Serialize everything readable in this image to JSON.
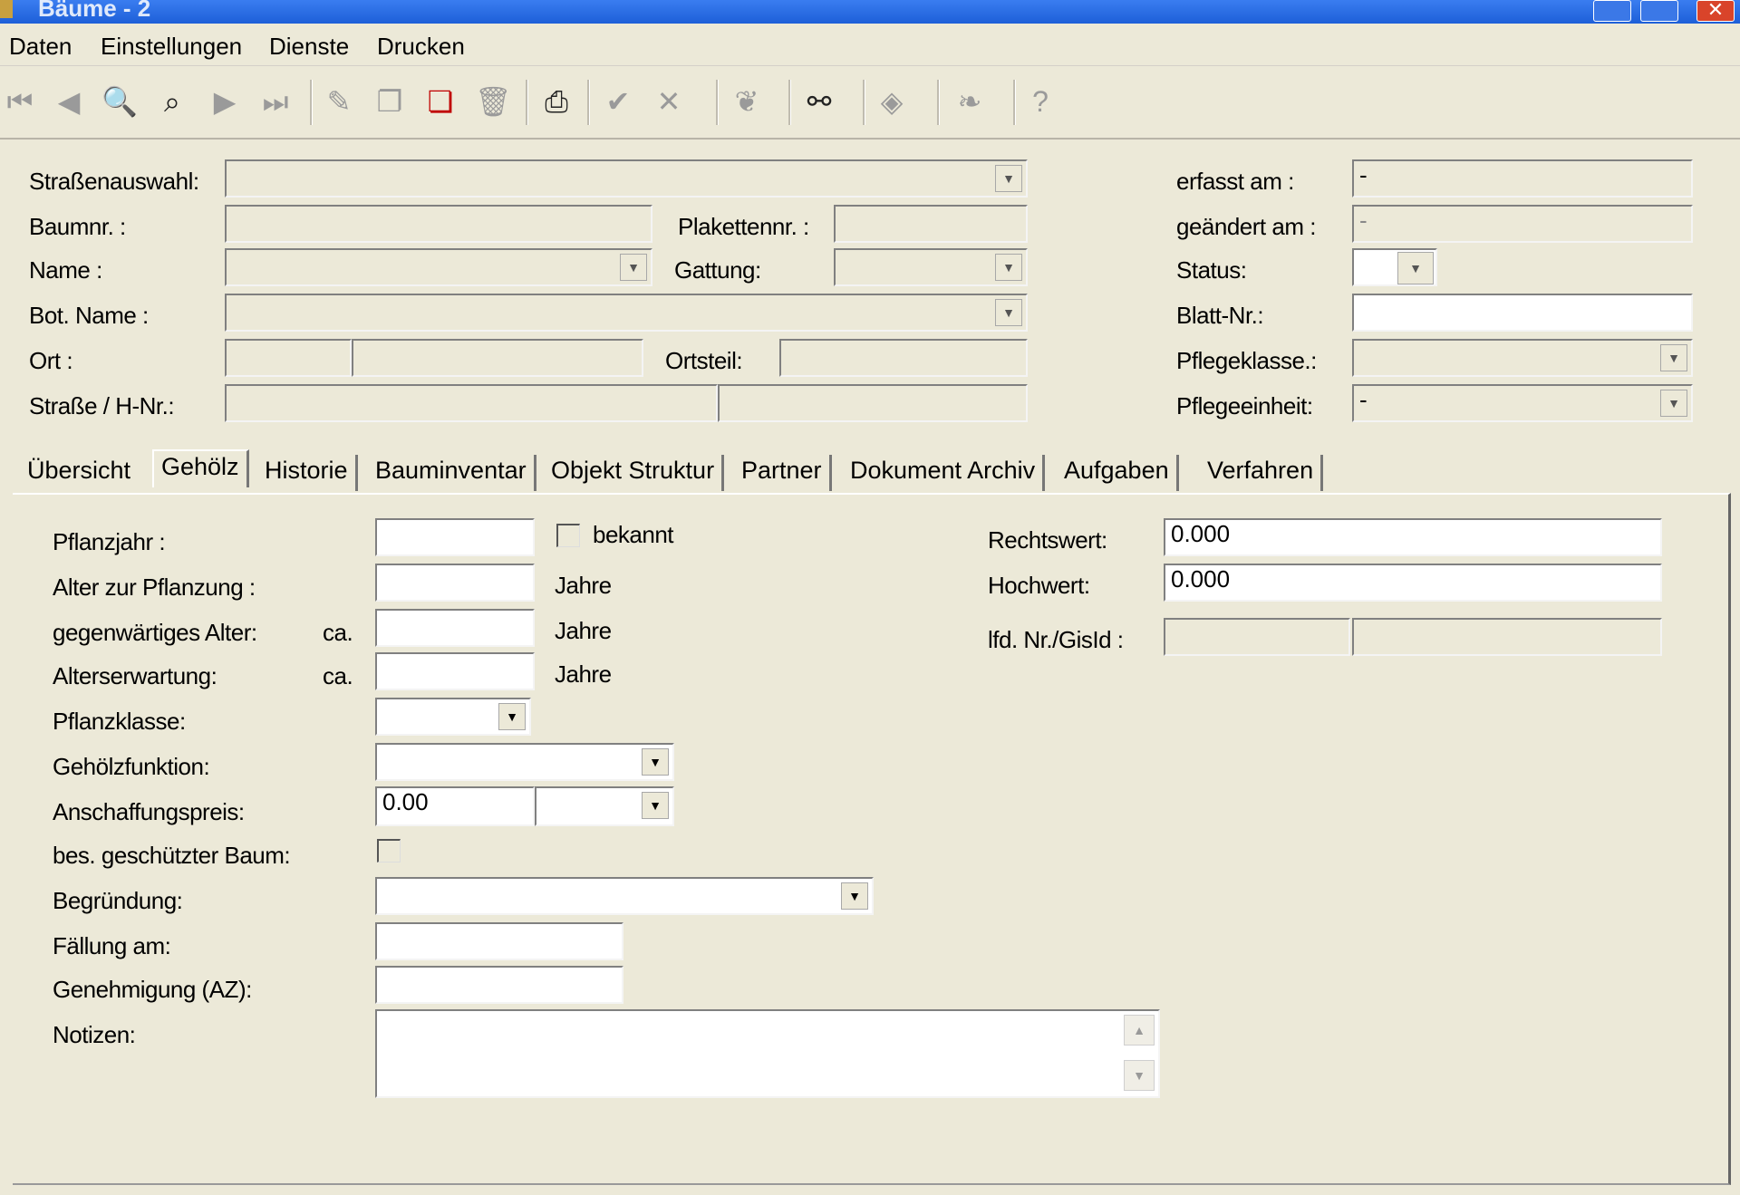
{
  "window": {
    "title": "Bäume - 2"
  },
  "menu": [
    "Daten",
    "Einstellungen",
    "Dienste",
    "Drucken"
  ],
  "toolbar": {
    "icons": [
      "first-record-icon",
      "prev-record-icon",
      "search-icon",
      "search-advanced-icon",
      "next-record-icon",
      "last-record-icon",
      "edit-icon",
      "copy-icon",
      "duplicate-icon",
      "delete-icon",
      "print-icon",
      "confirm-icon",
      "cancel-icon",
      "leaf-icon",
      "binoculars-icon",
      "eraser-icon",
      "leaf-filled-icon",
      "help-icon"
    ]
  },
  "header": {
    "strasse_label": "Straßenauswahl:",
    "strasse_value": "",
    "baumnr_label": "Baumnr. :",
    "baumnr_value": "",
    "plakette_label": "Plakettennr. :",
    "plakette_value": "",
    "name_label": "Name :",
    "name_value": "",
    "gattung_label": "Gattung:",
    "gattung_value": "",
    "botname_label": "Bot. Name :",
    "botname_value": "",
    "ort_label": "Ort :",
    "ort_code": "",
    "ort_value": "",
    "ortsteil_label": "Ortsteil:",
    "ortsteil_value": "",
    "strasse_hnr_label": "Straße / H-Nr.:",
    "strasse_hnr_value": "",
    "hnr_value": "",
    "erfasst_label": "erfasst am :",
    "erfasst_value": "-",
    "geaendert_label": "geändert am :",
    "geaendert_value": "-",
    "status_label": "Status:",
    "status_value": "",
    "blatt_label": "Blatt-Nr.:",
    "blatt_value": "",
    "pflegeklasse_label": "Pflegeklasse.:",
    "pflegeklasse_value": "",
    "pflegeeinheit_label": "Pflegeeinheit:",
    "pflegeeinheit_value": "-"
  },
  "tabs": [
    "Übersicht",
    "Gehölz",
    "Historie",
    "Bauminventar",
    "Objekt Struktur",
    "Partner",
    "Dokument Archiv",
    "Aufgaben",
    "Verfahren"
  ],
  "selected_tab": "Gehölz",
  "gehoelz": {
    "pflanzjahr_label": "Pflanzjahr :",
    "pflanzjahr_value": "",
    "bekannt_label": "bekannt",
    "bekannt_checked": false,
    "alter_pflanzung_label": "Alter zur Pflanzung :",
    "alter_pflanzung_value": "",
    "jahre1": "Jahre",
    "gegenwaertig_label": "gegenwärtiges Alter:",
    "ca1": "ca.",
    "gegenwaertig_value": "",
    "jahre2": "Jahre",
    "erwartung_label": "Alterserwartung:",
    "ca2": "ca.",
    "erwartung_value": "",
    "jahre3": "Jahre",
    "pflanzklasse_label": "Pflanzklasse:",
    "pflanzklasse_value": "",
    "funktion_label": "Gehölzfunktion:",
    "funktion_value": "",
    "preis_label": "Anschaffungspreis:",
    "preis_value": "0.00",
    "waehrung_value": "",
    "geschuetzt_label": "bes. geschützter Baum:",
    "geschuetzt_checked": false,
    "begruendung_label": "Begründung:",
    "begruendung_value": "",
    "faellung_label": "Fällung am:",
    "faellung_value": "",
    "genehmigung_label": "Genehmigung (AZ):",
    "genehmigung_value": "",
    "notizen_label": "Notizen:",
    "notizen_value": "",
    "rechtswert_label": "Rechtswert:",
    "rechtswert_value": "0.000",
    "hochwert_label": "Hochwert:",
    "hochwert_value": "0.000",
    "lfd_label": "lfd. Nr./GisId :",
    "lfd_value": "",
    "gisid_value": ""
  }
}
